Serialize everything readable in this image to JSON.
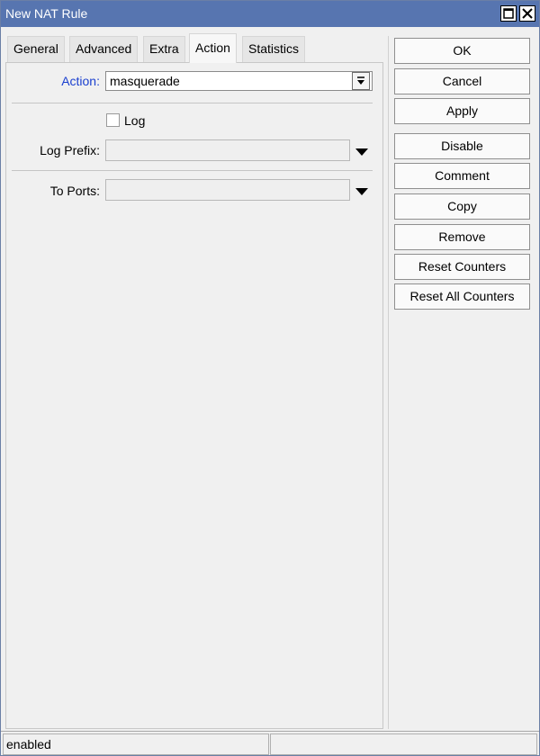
{
  "window": {
    "title": "New NAT Rule"
  },
  "tabs": [
    {
      "label": "General",
      "active": false
    },
    {
      "label": "Advanced",
      "active": false
    },
    {
      "label": "Extra",
      "active": false
    },
    {
      "label": "Action",
      "active": true
    },
    {
      "label": "Statistics",
      "active": false
    }
  ],
  "form": {
    "action_label": "Action:",
    "action_value": "masquerade",
    "log_label": "Log",
    "log_checked": false,
    "log_prefix_label": "Log Prefix:",
    "log_prefix_value": "",
    "to_ports_label": "To Ports:",
    "to_ports_value": ""
  },
  "buttons": [
    {
      "label": "OK"
    },
    {
      "label": "Cancel"
    },
    {
      "label": "Apply"
    },
    {
      "label": "Disable"
    },
    {
      "label": "Comment"
    },
    {
      "label": "Copy"
    },
    {
      "label": "Remove"
    },
    {
      "label": "Reset Counters"
    },
    {
      "label": "Reset All Counters"
    }
  ],
  "status": {
    "state": "enabled",
    "extra": ""
  },
  "icons": {
    "maximize": "maximize-icon",
    "close": "close-icon",
    "dropdown": "chevron-down-icon"
  },
  "colors": {
    "titlebar": "#5775b0",
    "action_label": "#1a3fcf"
  }
}
